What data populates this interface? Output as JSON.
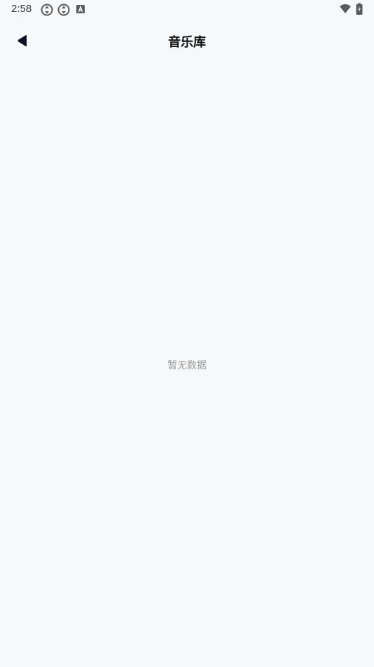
{
  "status_bar": {
    "time": "2:58",
    "icons": [
      "sync-icon",
      "sync-icon",
      "keyboard-a-icon",
      "wifi-icon",
      "battery-icon"
    ]
  },
  "nav": {
    "back_icon": "back-arrow-icon",
    "title": "音乐库"
  },
  "content": {
    "empty_text": "暂无数据"
  },
  "colors": {
    "background": "#f7f8fa",
    "title": "#111111",
    "empty_text": "#9a9a9a",
    "back_icon": "#0d1024"
  }
}
